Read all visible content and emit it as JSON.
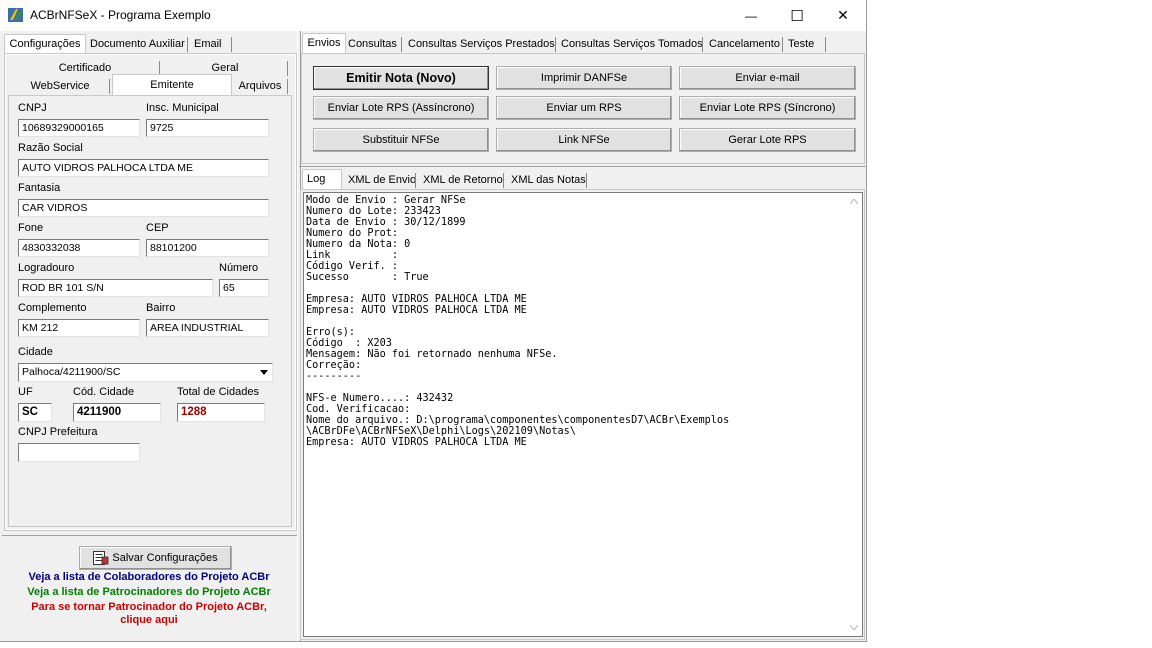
{
  "window": {
    "title": "ACBrNFSeX - Programa Exemplo",
    "minimize_symbol": "—",
    "maximize_symbol": "☐",
    "close_symbol": "✕"
  },
  "left": {
    "main_tabs": [
      "Configurações",
      "Documento Auxiliar",
      "Email"
    ],
    "sub_tabs_row1": [
      "Certificado",
      "Geral"
    ],
    "sub_tabs_row2": [
      "WebService",
      "Emitente",
      "Arquivos"
    ],
    "form": {
      "cnpj_label": "CNPJ",
      "cnpj": "10689329000165",
      "im_label": "Insc. Municipal",
      "im": "9725",
      "razao_label": "Razão Social",
      "razao": "AUTO VIDROS PALHOCA LTDA ME",
      "fantasia_label": "Fantasia",
      "fantasia": "CAR VIDROS",
      "fone_label": "Fone",
      "fone": "4830332038",
      "cep_label": "CEP",
      "cep": "88101200",
      "logradouro_label": "Logradouro",
      "logradouro": "ROD BR 101 S/N",
      "numero_label": "Número",
      "numero": "65",
      "complemento_label": "Complemento",
      "complemento": "KM 212",
      "bairro_label": "Bairro",
      "bairro": "AREA INDUSTRIAL",
      "cidade_label": "Cidade",
      "cidade": "Palhoca/4211900/SC",
      "uf_label": "UF",
      "uf": "SC",
      "cod_cidade_label": "Cód. Cidade",
      "cod_cidade": "4211900",
      "total_cidades_label": "Total de Cidades",
      "total_cidades": "1288",
      "cnpj_pref_label": "CNPJ Prefeitura",
      "cnpj_pref": ""
    },
    "save_button": "Salvar Configurações",
    "links": {
      "colaboradores": "Veja a lista de Colaboradores do Projeto ACBr",
      "patrocinadores": "Veja a lista de Patrocinadores do Projeto ACBr",
      "tornar_line1": "Para se tornar Patrocinador do Projeto ACBr,",
      "tornar_line2": "clique aqui"
    }
  },
  "right": {
    "main_tabs": [
      "Envios",
      "Consultas",
      "Consultas Serviços Prestados",
      "Consultas Serviços Tomados",
      "Cancelamento",
      "Teste"
    ],
    "buttons": {
      "emitir": "Emitir Nota (Novo)",
      "imprimir": "Imprimir DANFSe",
      "email": "Enviar e-mail",
      "lote_assinc": "Enviar Lote RPS (Assíncrono)",
      "um_rps": "Enviar um RPS",
      "lote_sinc": "Enviar Lote RPS (Síncrono)",
      "substituir": "Substituir NFSe",
      "link": "Link NFSe",
      "gerar": "Gerar Lote RPS"
    },
    "log_tabs": [
      "Log",
      "XML de Envio",
      "XML de Retorno",
      "XML das Notas"
    ],
    "log_text": "Modo de Envio : Gerar NFSe\nNumero do Lote: 233423\nData de Envio : 30/12/1899\nNumero do Prot:\nNumero da Nota: 0\nLink          :\nCódigo Verif. :\nSucesso       : True\n\nEmpresa: AUTO VIDROS PALHOCA LTDA ME\nEmpresa: AUTO VIDROS PALHOCA LTDA ME\n\nErro(s):\nCódigo  : X203\nMensagem: Não foi retornado nenhuma NFSe.\nCorreção:\n---------\n\nNFS-e Numero....: 432432\nCod. Verificacao:\nNome do arquivo.: D:\\programa\\componentes\\componentesD7\\ACBr\\Exemplos\n\\ACBrDFe\\ACBrNFSeX\\Delphi\\Logs\\202109\\Notas\\\nEmpresa: AUTO VIDROS PALHOCA LTDA ME"
  },
  "colors": {
    "colaboradores": "#00007f",
    "patrocinadores": "#007f00",
    "tornar": "#cc0000",
    "total_cidades": "#a00000"
  }
}
